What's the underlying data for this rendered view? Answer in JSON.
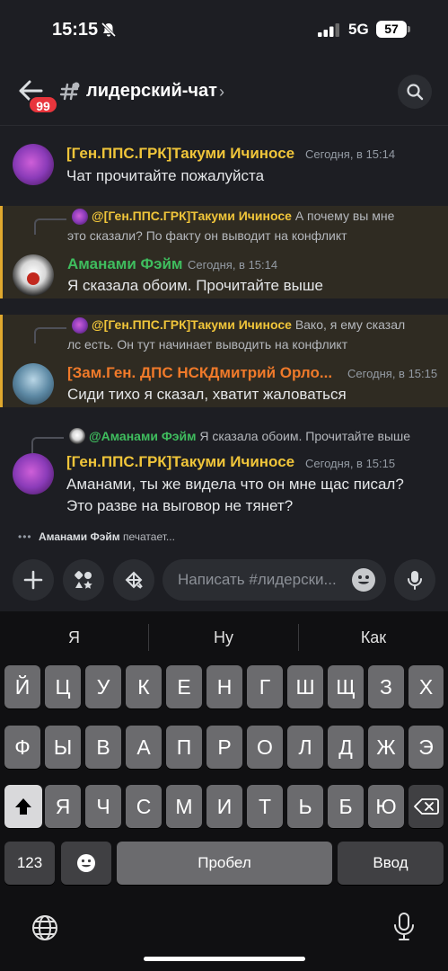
{
  "status_bar": {
    "time": "15:15",
    "network": "5G",
    "battery": "57"
  },
  "header": {
    "badge": "99",
    "channel_name": "лидерский-чат",
    "arrow": "›"
  },
  "messages": [
    {
      "author": "[Ген.ППС.ГРК]Такуми Ичиносе",
      "timestamp": "Сегодня, в 15:14",
      "text": "Чат прочитайте пожалуйста"
    },
    {
      "reply_author": "@[Ген.ППС.ГРК]Такуми Ичиносе",
      "reply_text": "А почему вы мне",
      "reply_text2": "это сказали? По факту он выводит на конфликт",
      "author": "Аманами Фэйм",
      "timestamp": "Сегодня, в 15:14",
      "text": "Я сказала обоим. Прочитайте выше"
    },
    {
      "reply_author": "@[Ген.ППС.ГРК]Такуми Ичиносе",
      "reply_text": "Вако, я ему сказал",
      "reply_text2": "лс есть. Он тут начинает выводить на конфликт",
      "author": "[Зам.Ген. ДПС НСКДмитрий Орло...",
      "timestamp": "Сегодня, в 15:15",
      "text": "Сиди тихо я сказал, хватит жаловаться"
    },
    {
      "reply_author": "@Аманами Фэйм",
      "reply_text": "Я сказала обоим. Прочитайте выше",
      "author": "[Ген.ППС.ГРК]Такуми Ичиносе",
      "timestamp": "Сегодня, в 15:15",
      "text_line1": "Аманами, ты же видела что он мне щас писал?",
      "text_line2": "Это разве на выговор не тянет?"
    }
  ],
  "typing": {
    "dots": "•••",
    "user": "Аманами Фэйм",
    "suffix": "печатает..."
  },
  "composer": {
    "placeholder": "Написать #лидерски..."
  },
  "keyboard": {
    "suggestions": [
      "Я",
      "Ну",
      "Как"
    ],
    "row1": [
      "Й",
      "Ц",
      "У",
      "К",
      "Е",
      "Н",
      "Г",
      "Ш",
      "Щ",
      "З",
      "Х"
    ],
    "row2": [
      "Ф",
      "Ы",
      "В",
      "А",
      "П",
      "Р",
      "О",
      "Л",
      "Д",
      "Ж",
      "Э"
    ],
    "row3": [
      "Я",
      "Ч",
      "С",
      "М",
      "И",
      "Т",
      "Ь",
      "Б",
      "Ю"
    ],
    "numbers_label": "123",
    "space_label": "Пробел",
    "return_label": "Ввод"
  }
}
